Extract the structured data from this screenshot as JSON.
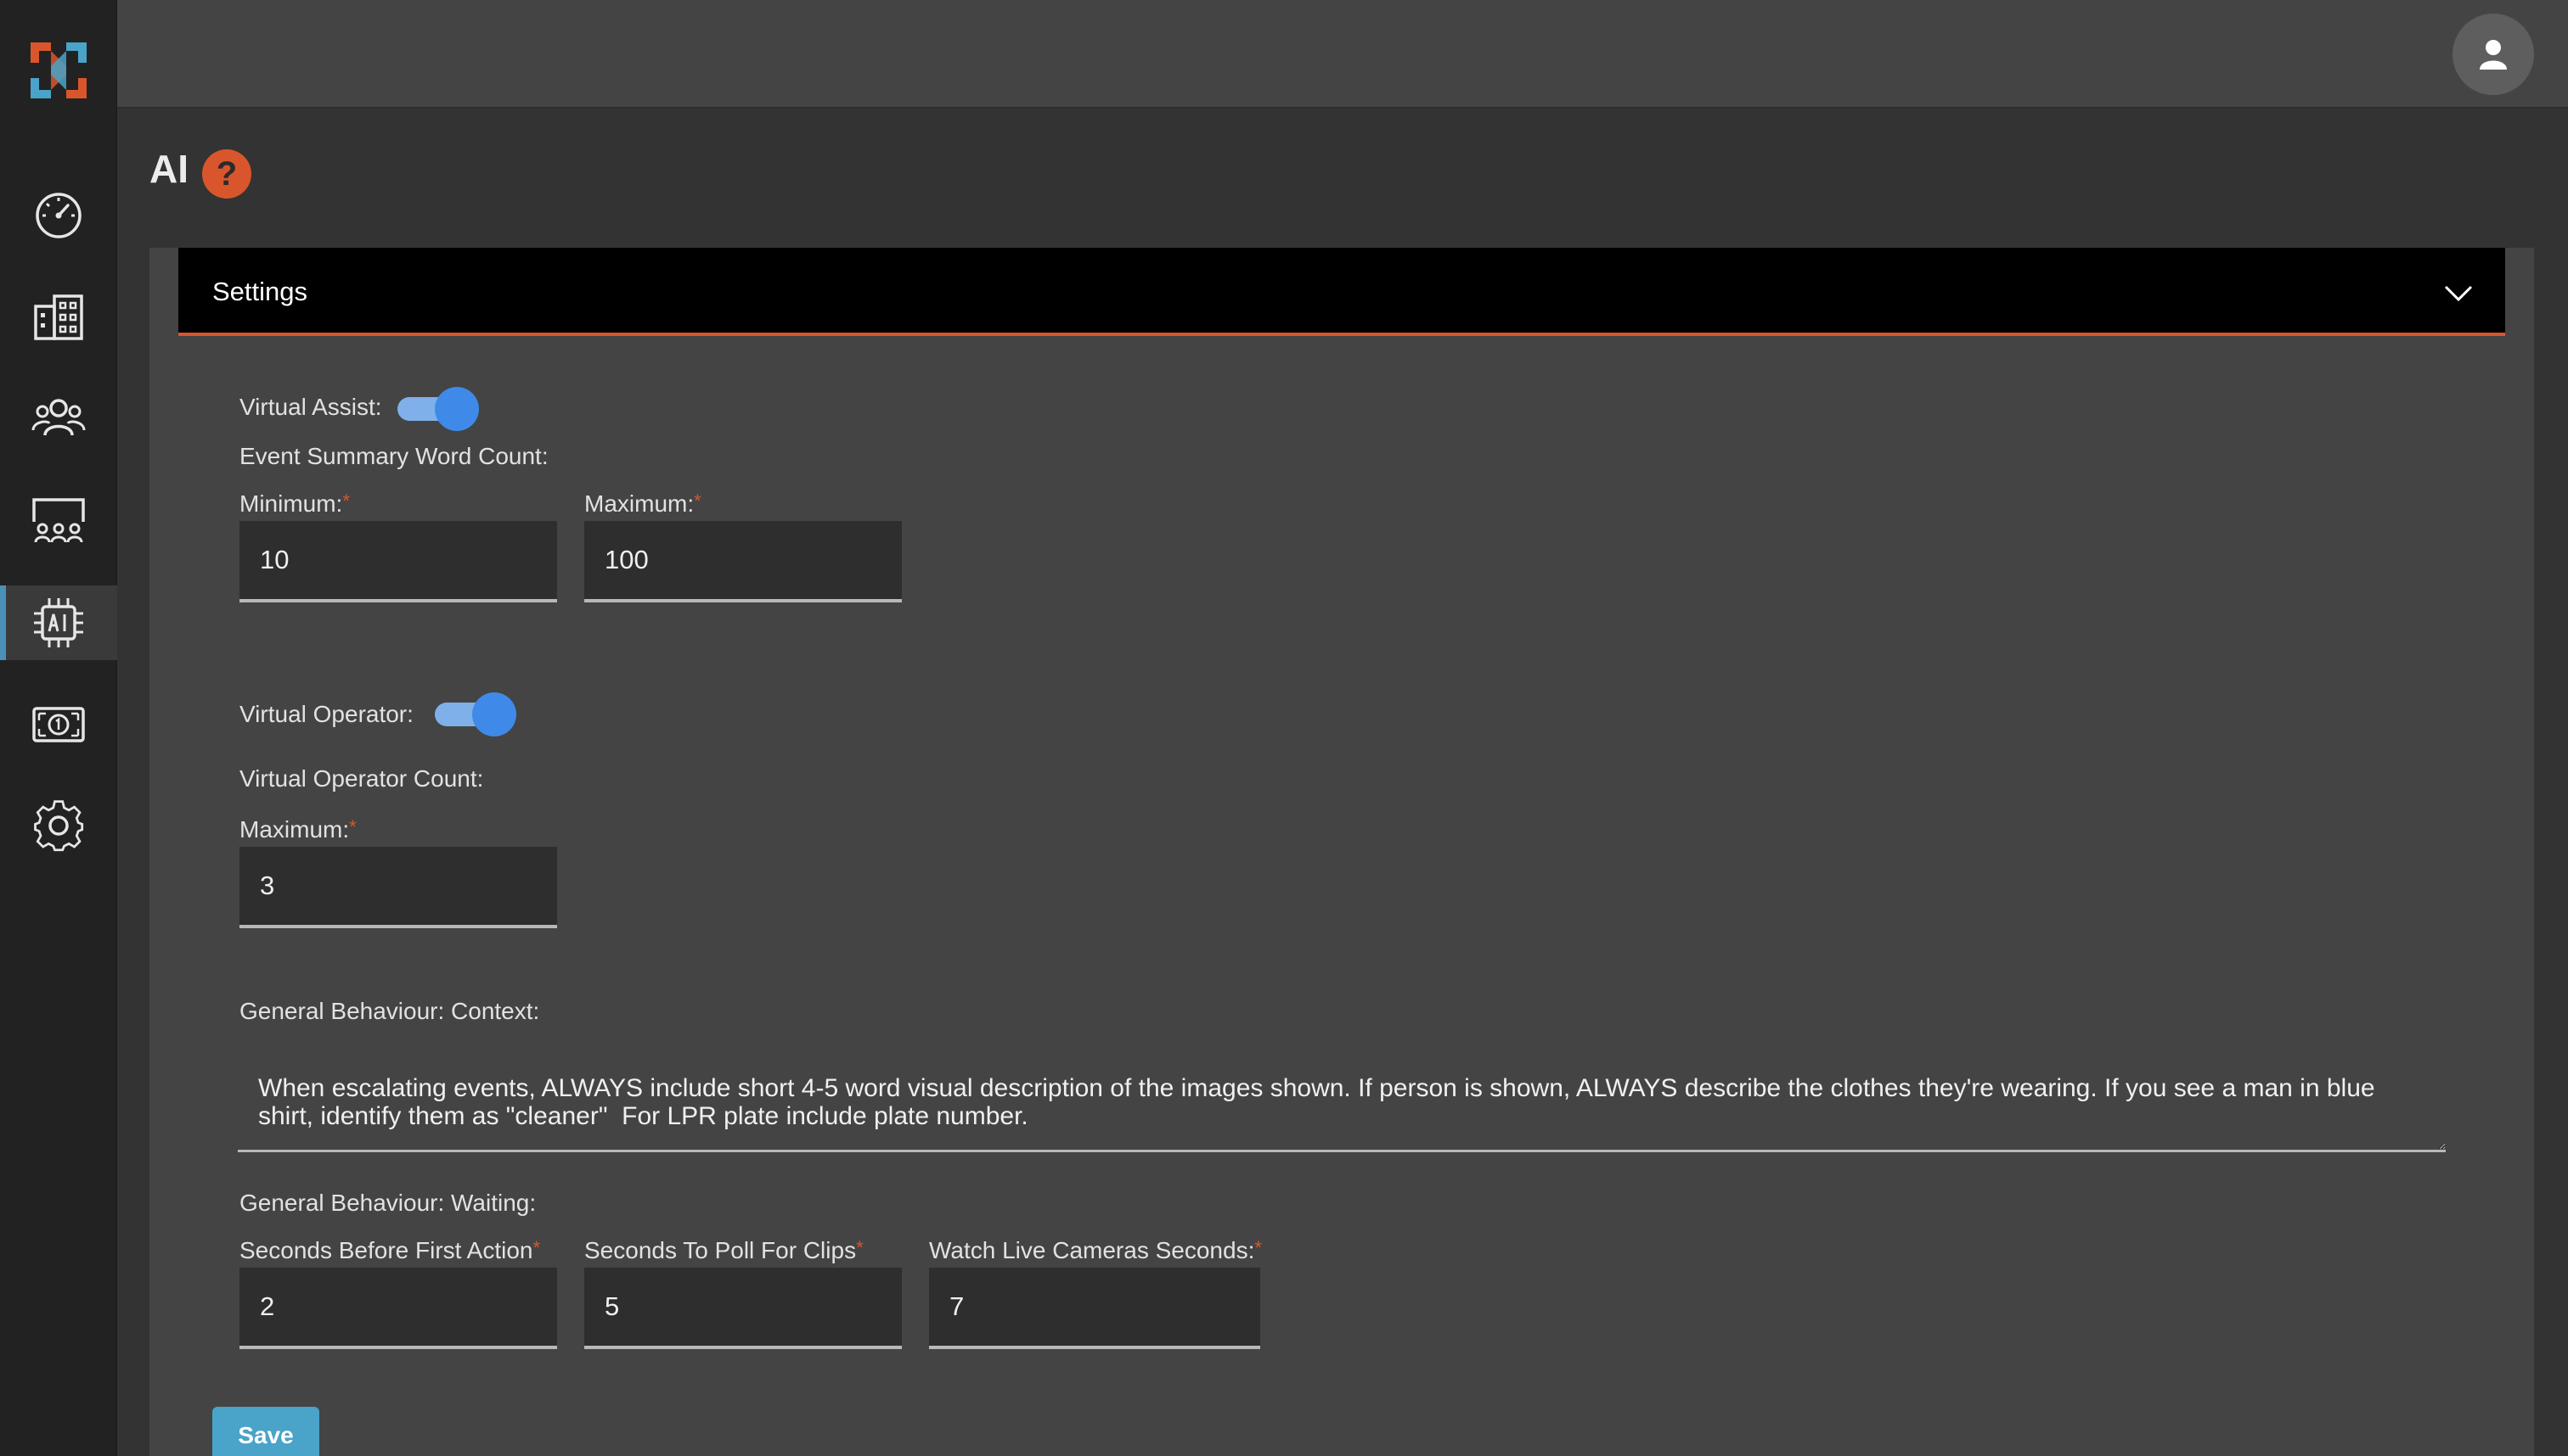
{
  "page": {
    "title": "AI",
    "help_icon": "question-mark-icon",
    "accent_color": "#d9562c",
    "link_color": "#4aa3c8"
  },
  "sidebar": {
    "items": [
      {
        "name": "dashboard-icon",
        "active": false
      },
      {
        "name": "buildings-icon",
        "active": false
      },
      {
        "name": "users-icon",
        "active": false
      },
      {
        "name": "operators-icon",
        "active": false
      },
      {
        "name": "ai-chip-icon",
        "active": true
      },
      {
        "name": "billing-icon",
        "active": false
      },
      {
        "name": "gear-icon",
        "active": false
      }
    ]
  },
  "panel": {
    "title": "Settings",
    "virtual_assist": {
      "label": "Virtual Assist:",
      "enabled": true
    },
    "summary_word_count": {
      "label": "Event Summary Word Count:",
      "minimum_label": "Minimum:",
      "minimum_value": "10",
      "maximum_label": "Maximum:",
      "maximum_value": "100"
    },
    "virtual_operator": {
      "label": "Virtual Operator:",
      "enabled": true
    },
    "operator_count": {
      "label": "Virtual Operator Count:",
      "maximum_label": "Maximum:",
      "maximum_value": "3"
    },
    "context": {
      "label": "General Behaviour: Context:",
      "value": "When escalating events, ALWAYS include short 4-5 word visual description of the images shown. If person is shown, ALWAYS describe the clothes they're wearing. If you see a man in blue shirt, identify them as \"cleaner\"  For LPR plate include plate number."
    },
    "waiting": {
      "label": "General Behaviour: Waiting:",
      "first_action_label": "Seconds Before First Action",
      "first_action_value": "2",
      "poll_label": "Seconds To Poll For Clips",
      "poll_value": "5",
      "watch_label": "Watch Live Cameras Seconds:",
      "watch_value": "7"
    },
    "required_mark": "*",
    "save_label": "Save"
  }
}
